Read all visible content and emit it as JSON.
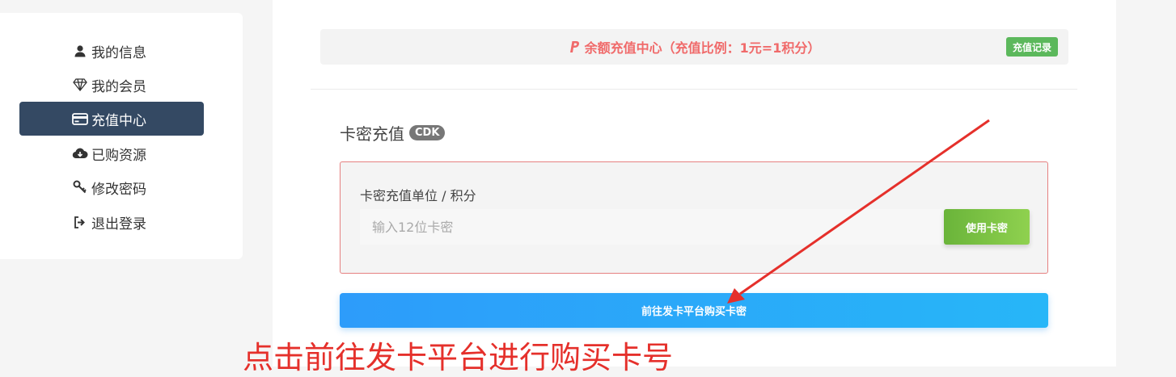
{
  "sidebar": {
    "items": [
      {
        "label": "我的信息",
        "icon": "user-icon",
        "active": false
      },
      {
        "label": "我的会员",
        "icon": "diamond-icon",
        "active": false
      },
      {
        "label": "充值中心",
        "icon": "credit-card-icon",
        "active": true
      },
      {
        "label": "已购资源",
        "icon": "cloud-download-icon",
        "active": false
      },
      {
        "label": "修改密码",
        "icon": "key-icon",
        "active": false
      },
      {
        "label": "退出登录",
        "icon": "sign-out-icon",
        "active": false
      }
    ]
  },
  "topbar": {
    "title": "余额充值中心（充值比例：1元=1积分）",
    "icon": "paypal-icon",
    "record_button": "充值记录"
  },
  "cdk": {
    "title": "卡密充值",
    "badge": "CDK",
    "label": "卡密充值单位 / 积分",
    "placeholder": "输入12位卡密",
    "use_button": "使用卡密"
  },
  "go_button": "前往发卡平台购买卡密",
  "annotation": "点击前往发卡平台进行购买卡号",
  "colors": {
    "sidebar_active": "#344963",
    "topbar_text": "#f06a6a",
    "record_button": "#5cb85c",
    "cdk_border": "#e58080",
    "use_button": "#7cc447",
    "go_button": "#2aa6f9",
    "annotation": "#e5302b"
  }
}
